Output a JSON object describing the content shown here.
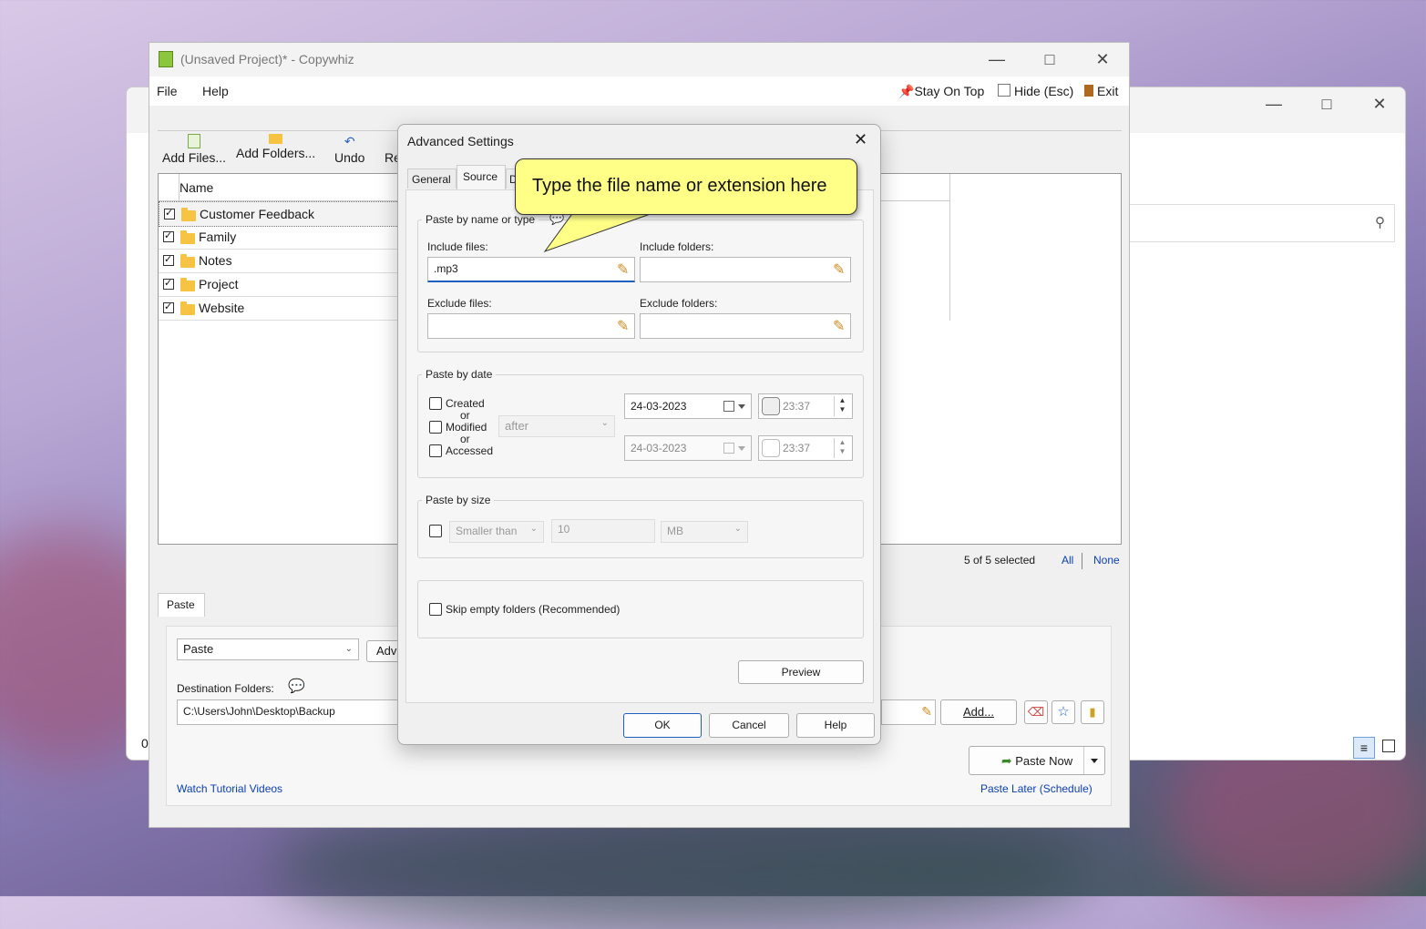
{
  "main_window": {
    "title": "(Unsaved Project)* - Copywhiz",
    "menu": [
      "File",
      "Help"
    ],
    "right_menu": {
      "stay_on_top": "Stay On Top",
      "hide": "Hide (Esc)",
      "exit": "Exit"
    },
    "toolbar": {
      "add_files": "Add Files...",
      "add_folders": "Add Folders...",
      "undo": "Undo",
      "redo_partial": "Re"
    },
    "list": {
      "column_name": "Name",
      "items": [
        "Customer Feedback",
        "Family",
        "Notes",
        "Project",
        "Website"
      ],
      "selection_count": "5 of 5 selected",
      "all": "All",
      "none": "None"
    },
    "paste_panel": {
      "tab": "Paste",
      "mode_value": "Paste",
      "advanced_partial": "Adva",
      "dest_label": "Destination Folders:",
      "dest_value": "C:\\Users\\John\\Desktop\\Backup",
      "add_button": "Add...",
      "paste_now": "Paste Now",
      "paste_later": "Paste Later (Schedule)",
      "tutorial": "Watch Tutorial Videos"
    }
  },
  "bg_window": {
    "status_partial": "0"
  },
  "dialog": {
    "title": "Advanced Settings",
    "tabs": {
      "general": "General",
      "source": "Source",
      "dest_partial": "D"
    },
    "name_group": {
      "label": "Paste by name or type",
      "include_files_label": "Include files:",
      "include_files_value": ".mp3",
      "include_folders_label": "Include folders:",
      "exclude_files_label": "Exclude files:",
      "exclude_folders_label": "Exclude folders:"
    },
    "date_group": {
      "label": "Paste by date",
      "created": "Created",
      "or1": "or",
      "modified": "Modified",
      "or2": "or",
      "accessed": "Accessed",
      "relation": "after",
      "date1": "24-03-2023",
      "time1": "23:37",
      "date2": "24-03-2023",
      "time2": "23:37"
    },
    "size_group": {
      "label": "Paste by size",
      "comparison": "Smaller than",
      "value": "10",
      "unit": "MB"
    },
    "skip_empty": "Skip empty folders (Recommended)",
    "preview": "Preview",
    "ok": "OK",
    "cancel": "Cancel",
    "help": "Help"
  },
  "callout": {
    "text": "Type the file name or extension here"
  },
  "colors": {
    "accent": "#0b3fb3",
    "callout_bg": "#ffff88",
    "focus": "#1f5fbf"
  }
}
